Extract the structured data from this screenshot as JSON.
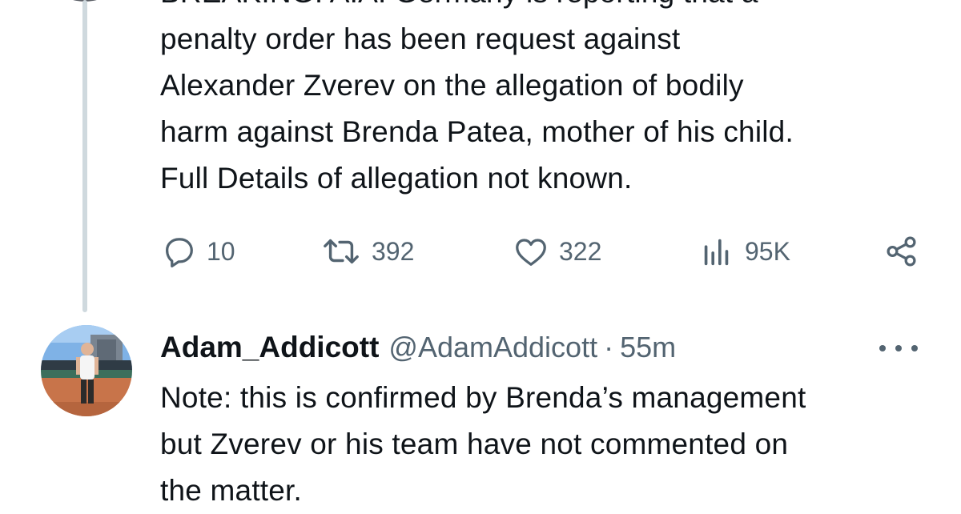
{
  "first_tweet": {
    "lines": [
      "BREAKING: A.A. Germany is reporting that a",
      "penalty order has been request against",
      "Alexander Zverev on the allegation of bodily",
      "harm against Brenda Patea, mother of his child.",
      "Full Details of allegation not known."
    ],
    "actions": {
      "replies": "10",
      "retweets": "392",
      "likes": "322",
      "views": "95K"
    }
  },
  "reply_tweet": {
    "author_name": "Adam_Addicott",
    "handle": "@AdamAddicott",
    "separator": "·",
    "time": "55m",
    "lines": [
      "Note: this is confirmed by Brenda’s management",
      "but Zverev or his team have not commented on",
      "the matter."
    ]
  },
  "icons": {
    "reply": "reply-icon",
    "retweet": "retweet-icon",
    "like": "heart-icon",
    "views": "views-icon",
    "share": "share-icon",
    "more": "more-icon"
  },
  "colors": {
    "text": "#0f1419",
    "secondary": "#536471",
    "thread_line": "#cfd9de"
  }
}
